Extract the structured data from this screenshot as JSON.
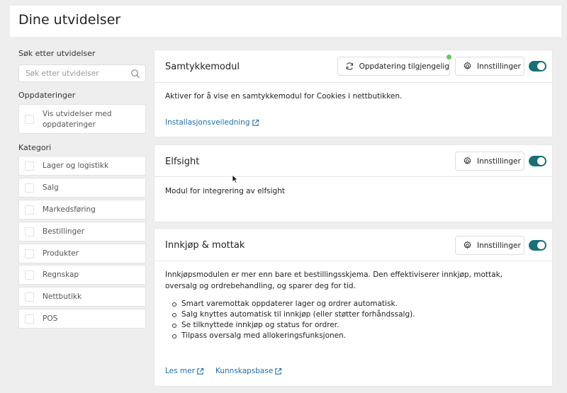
{
  "page": {
    "title": "Dine utvidelser"
  },
  "sidebar": {
    "search_label": "Søk etter utvidelser",
    "search_placeholder": "Søk etter utvidelser",
    "updates_label": "Oppdateringer",
    "updates_option": "Vis utvidelser med oppdateringer",
    "category_label": "Kategori",
    "categories": [
      "Lager og logistikk",
      "Salg",
      "Markedsføring",
      "Bestillinger",
      "Produkter",
      "Regnskap",
      "Nettbutikk",
      "POS"
    ]
  },
  "panels": [
    {
      "title": "Samtykkemodul",
      "update_label": "Oppdatering tilgjengelig",
      "settings_label": "Innstillinger",
      "enabled": true,
      "description": "Aktiver for å vise en samtykkemodul for Cookies i nettbutikken.",
      "links": [
        "Installasjonsveiledning"
      ]
    },
    {
      "title": "Elfsight",
      "settings_label": "Innstillinger",
      "enabled": true,
      "description": "Modul for integrering av elfsight"
    },
    {
      "title": "Innkjøp & mottak",
      "settings_label": "Innstillinger",
      "enabled": true,
      "description": "Innkjøpsmodulen er mer enn bare et bestillingsskjema. Den effektiviserer innkjøp, mottak, oversalg og ordrebehandling, og sparer deg for tid.",
      "features": [
        "Smart varemottak oppdaterer lager og ordrer automatisk.",
        "Salg knyttes automatisk til innkjøp (eller støtter forhåndssalg).",
        "Se tilknyttede innkjøp og status for ordrer.",
        "Tilpass oversalg med allokeringsfunksjonen."
      ],
      "links": [
        "Les mer",
        "Kunnskapsbase"
      ]
    }
  ],
  "colors": {
    "toggle_on": "#1a6f76",
    "link": "#1f6ea8",
    "update_dot": "#6bc46b"
  },
  "icons": {
    "search": "search-icon",
    "refresh": "refresh-icon",
    "settings": "gear-icon",
    "external": "external-link-icon"
  }
}
